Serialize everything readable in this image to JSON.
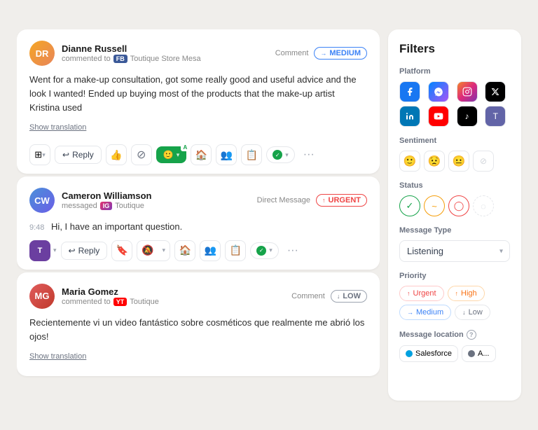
{
  "messages": [
    {
      "id": "msg1",
      "user_name": "Dianne Russell",
      "user_initials": "DR",
      "action": "commented to",
      "platform": "FB",
      "store": "Toutique Store Mesa",
      "type_label": "Comment",
      "priority": "MEDIUM",
      "priority_type": "medium",
      "message_text": "Went for a make-up consultation, got some really good and useful advice and the look I wanted! Ended up buying most of the products that the make-up artist Kristina used",
      "show_translation": "Show translation",
      "reply_label": "Reply",
      "timestamp": ""
    },
    {
      "id": "msg2",
      "user_name": "Cameron Williamson",
      "user_initials": "CW",
      "action": "messaged",
      "platform": "IG",
      "store": "Toutique",
      "type_label": "Direct Message",
      "priority": "URGENT",
      "priority_type": "urgent",
      "message_text": "Hi, I have an important question.",
      "show_translation": "",
      "reply_label": "Reply",
      "timestamp": "9:48"
    },
    {
      "id": "msg3",
      "user_name": "Maria Gomez",
      "user_initials": "MG",
      "action": "commented to",
      "platform": "YT",
      "store": "Toutique",
      "type_label": "Comment",
      "priority": "LOW",
      "priority_type": "low",
      "message_text": "Recientemente vi un video fantástico sobre cosméticos que realmente me abrió los ojos!",
      "show_translation": "Show translation",
      "reply_label": "Reply",
      "timestamp": ""
    }
  ],
  "filters": {
    "title": "Filters",
    "platform_label": "Platform",
    "sentiment_label": "Sentiment",
    "status_label": "Status",
    "message_type_label": "Message type",
    "message_type_value": "Listening",
    "priority_label": "Priority",
    "message_location_label": "Message location",
    "priority_buttons": [
      {
        "label": "Urgent",
        "type": "urgent"
      },
      {
        "label": "High",
        "type": "high"
      },
      {
        "label": "Medium",
        "type": "medium"
      },
      {
        "label": "Low",
        "type": "low"
      }
    ],
    "location_buttons": [
      {
        "label": "Salesforce",
        "type": "salesforce"
      },
      {
        "label": "A...",
        "type": "admins"
      }
    ]
  }
}
